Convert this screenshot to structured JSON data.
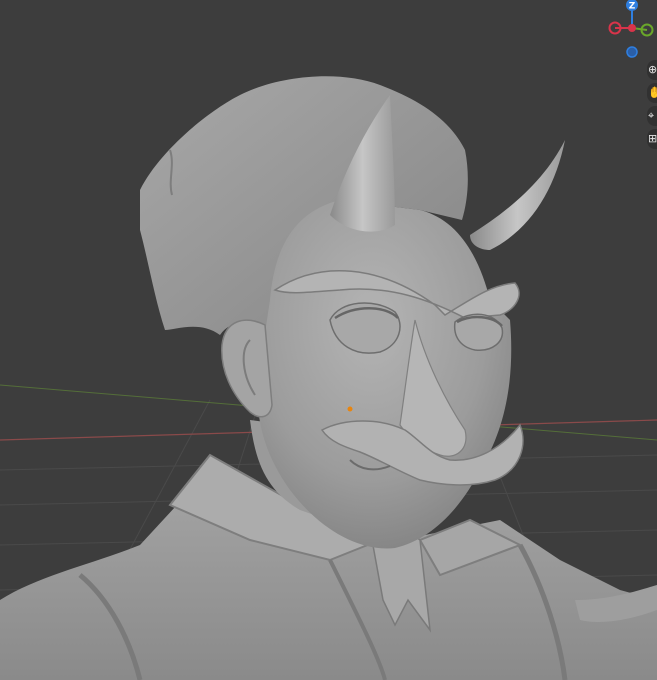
{
  "viewport": {
    "background": "#3d3d3d",
    "grid_line_color": "#4a4a4a",
    "x_axis_color": "#8a4a4a",
    "y_axis_color": "#5a7a38",
    "model_color": "#9a9a9a",
    "origin_color": "#e8850f"
  },
  "gizmo": {
    "z_label": "Z",
    "z_color": "#2f7fe0",
    "x_color": "#d8344a",
    "y_color": "#6aa72a"
  },
  "nav_tools": [
    {
      "name": "zoom-icon",
      "glyph": "⊕"
    },
    {
      "name": "pan-hand-icon",
      "glyph": "✋"
    },
    {
      "name": "camera-view-icon",
      "glyph": "⌖"
    },
    {
      "name": "grid-view-icon",
      "glyph": "⊞"
    }
  ]
}
